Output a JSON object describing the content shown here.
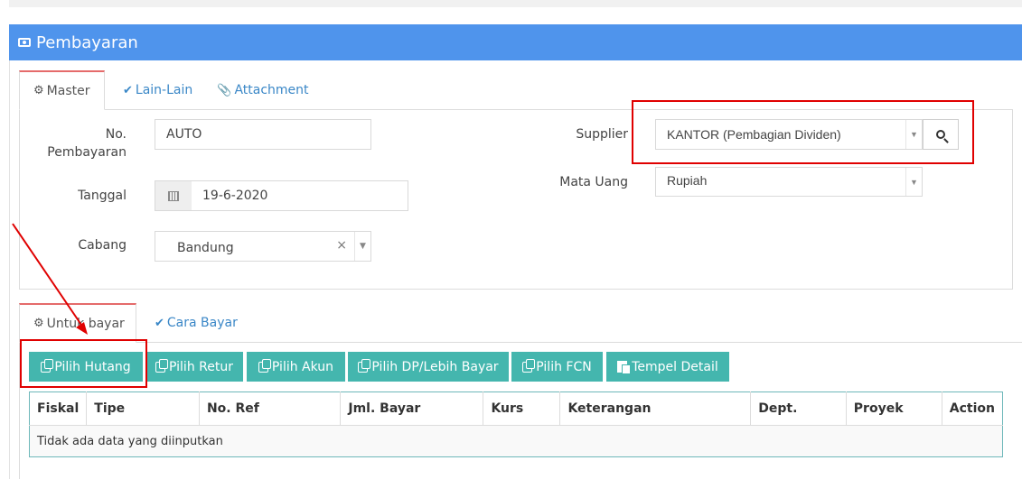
{
  "panel": {
    "title": "Pembayaran",
    "icon": "money-icon"
  },
  "tabs_top": [
    {
      "label": "Master",
      "icon": "cogs-icon"
    },
    {
      "label": "Lain-Lain",
      "icon": "check-circle-icon"
    },
    {
      "label": "Attachment",
      "icon": "paperclip-icon"
    }
  ],
  "form": {
    "no_pembayaran_label_1": "No.",
    "no_pembayaran_label_2": "Pembayaran",
    "no_pembayaran_value": "AUTO",
    "tanggal_label": "Tanggal",
    "tanggal_value": "19-6-2020",
    "cabang_label": "Cabang",
    "cabang_value": "Bandung",
    "cabang_clear": "×",
    "supplier_label": "Supplier",
    "supplier_value": "KANTOR (Pembagian Dividen)",
    "mata_uang_label": "Mata Uang",
    "mata_uang_value": "Rupiah",
    "arrow": "▼"
  },
  "tabs_bottom": [
    {
      "label": "Untuk bayar",
      "icon": "cogs-icon"
    },
    {
      "label": "Cara Bayar",
      "icon": "check-circle-icon"
    }
  ],
  "buttons": {
    "pilih_hutang": "Pilih Hutang",
    "pilih_retur": "Pilih Retur",
    "pilih_akun": "Pilih Akun",
    "pilih_dp": "Pilih DP/Lebih Bayar",
    "pilih_fcn": "Pilih FCN",
    "tempel_detail": "Tempel Detail"
  },
  "table": {
    "columns": [
      "Fiskal",
      "Tipe",
      "No. Ref",
      "Jml. Bayar",
      "Kurs",
      "Keterangan",
      "Dept.",
      "Proyek",
      "Action"
    ],
    "empty_message": "Tidak ada data yang diinputkan"
  },
  "colors": {
    "header": "#4f94ec",
    "button": "#44b6ae",
    "tab_active_border": "#e56b6b",
    "annotation": "#e00000"
  }
}
